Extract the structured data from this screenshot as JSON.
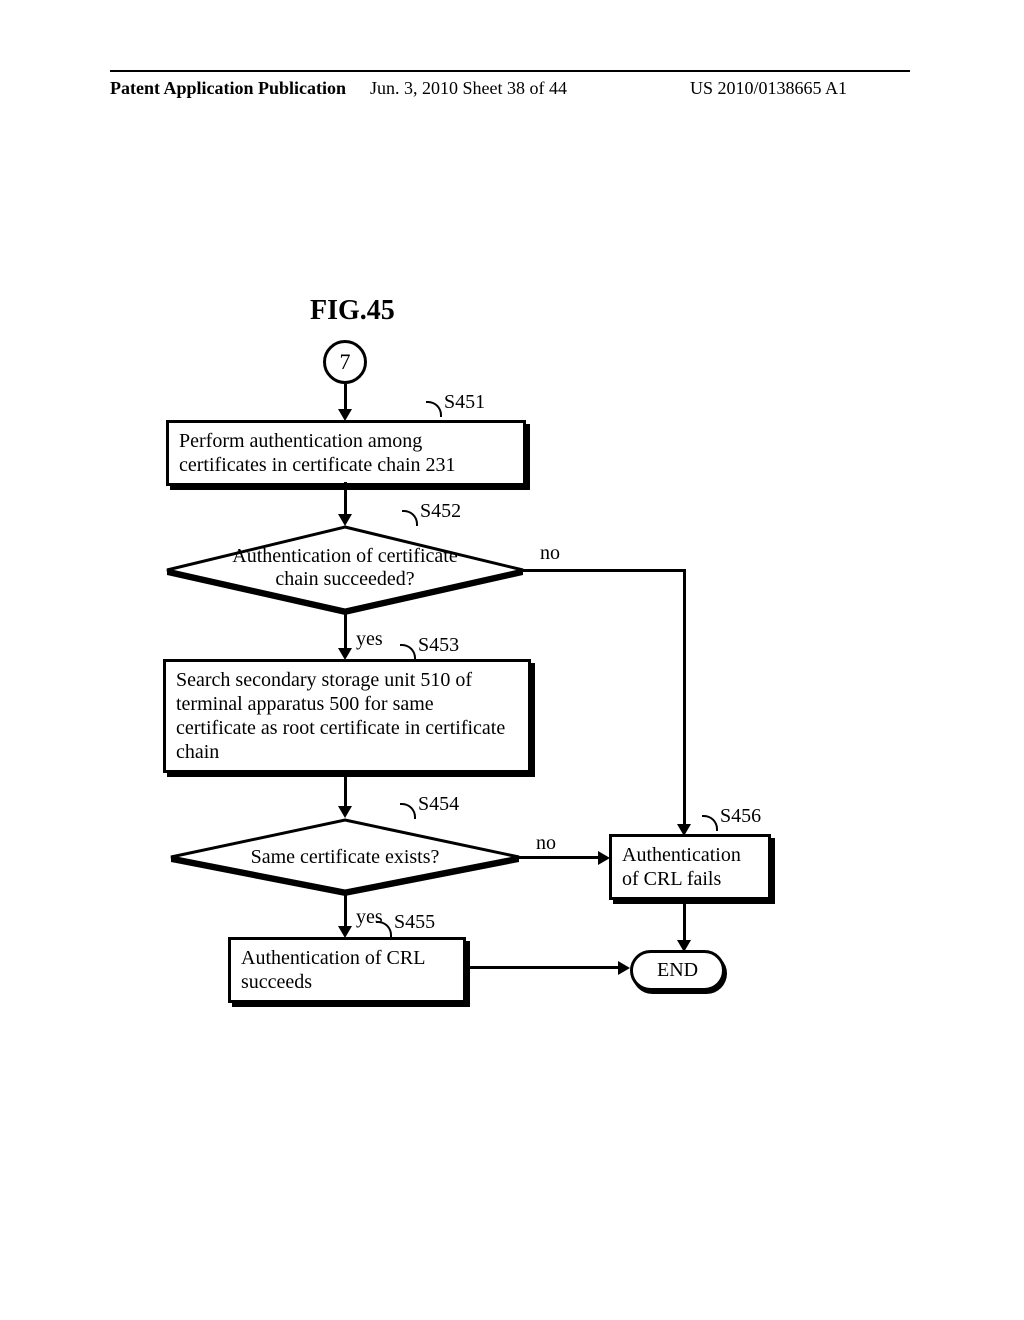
{
  "header": {
    "left": "Patent Application Publication",
    "center": "Jun. 3, 2010  Sheet 38 of 44",
    "right": "US 2010/0138665 A1"
  },
  "figure_title": "FIG.45",
  "connector_label": "7",
  "steps": {
    "s451": {
      "label": "S451",
      "text": "Perform authentication among certificates in certificate chain 231"
    },
    "s452": {
      "label": "S452",
      "text": "Authentication of certificate chain succeeded?"
    },
    "s453": {
      "label": "S453",
      "text": "Search secondary storage unit 510 of terminal apparatus 500 for same certificate as root certificate in certificate chain"
    },
    "s454": {
      "label": "S454",
      "text": "Same certificate exists?"
    },
    "s455": {
      "label": "S455",
      "text": "Authentication of CRL succeeds"
    },
    "s456": {
      "label": "S456",
      "text": "Authentication of CRL fails"
    }
  },
  "edges": {
    "yes": "yes",
    "no": "no"
  },
  "terminator": "END"
}
